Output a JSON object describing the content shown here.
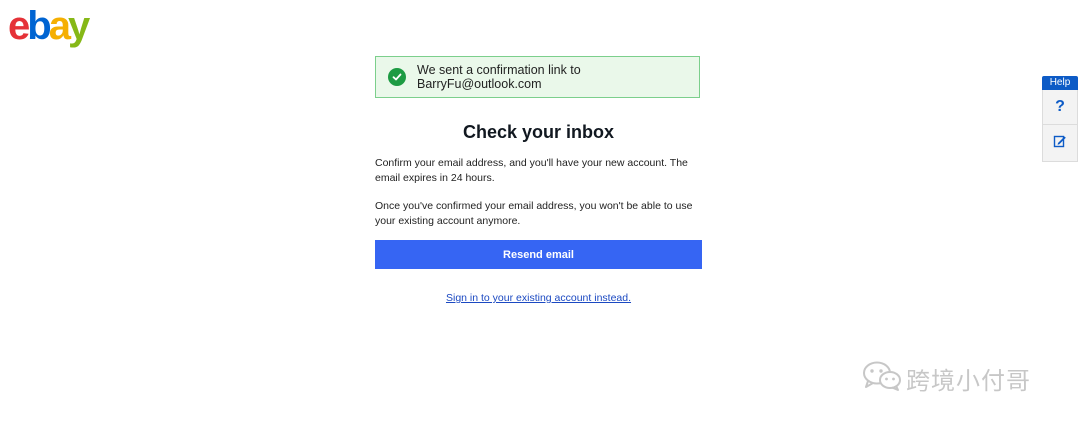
{
  "logo": {
    "letters": [
      "e",
      "b",
      "a",
      "y"
    ],
    "colors": [
      "#e53238",
      "#0064d2",
      "#f5af02",
      "#86b817"
    ]
  },
  "alert": {
    "icon": "check-circle-icon",
    "text": "We sent a confirmation link to BarryFu@outlook.com",
    "accent": "#1d9b43"
  },
  "main": {
    "heading": "Check your inbox",
    "paragraph1": "Confirm your email address, and you'll have your new account. The email expires in 24 hours.",
    "paragraph2": "Once you've confirmed your email address, you won't be able to use your existing account anymore.",
    "resend_label": "Resend email",
    "signin_link": "Sign in to your existing account instead."
  },
  "help": {
    "tab_label": "Help",
    "question_glyph": "?",
    "icons": [
      "question-icon",
      "feedback-icon"
    ]
  },
  "watermark": {
    "text": "跨境小付哥"
  },
  "colors": {
    "primary_button": "#3665f3",
    "link": "#1b49c2",
    "help_blue": "#0d5bc6"
  }
}
